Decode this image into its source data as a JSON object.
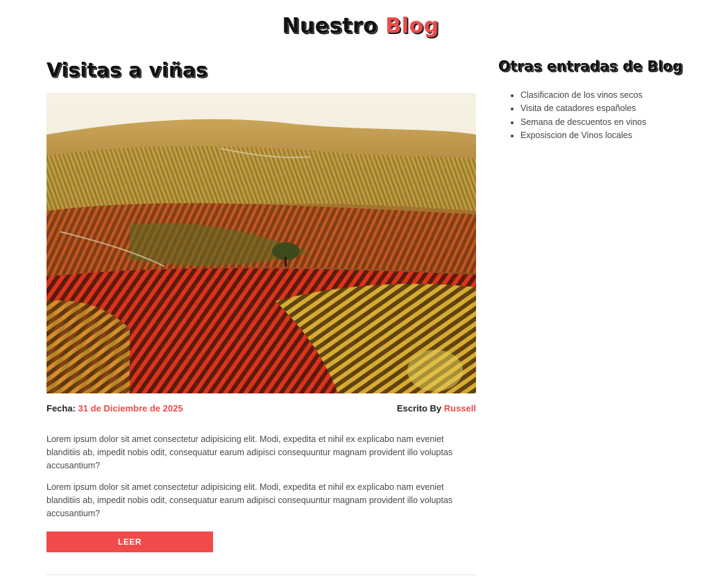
{
  "header": {
    "title_part1": "Nuestro",
    "title_part2": "Blog"
  },
  "post": {
    "title": "Visitas a viñas",
    "date_label": "Fecha:",
    "date_value": "31 de Diciembre de 2025",
    "author_label": "Escrito By",
    "author_value": "Russell",
    "paragraphs": [
      "Lorem ipsum dolor sit amet consectetur adipisicing elit. Modi, expedita et nihil ex explicabo nam eveniet blanditiis ab, impedit nobis odit, consequatur earum adipisci consequuntur magnam provident illo voluptas accusantium?",
      "Lorem ipsum dolor sit amet consectetur adipisicing elit. Modi, expedita et nihil ex explicabo nam eveniet blanditiis ab, impedit nobis odit, consequatur earum adipisci consequuntur magnam provident illo voluptas accusantium?"
    ],
    "button_label": "LEER",
    "image_icon": "vineyard-landscape-image"
  },
  "sidebar": {
    "title": "Otras entradas de Blog",
    "items": [
      "Clasificacion de los vinos secos",
      "Visita de catadores españoles",
      "Semana de descuentos en vinos",
      "Exposiscion de Vinos locales"
    ]
  },
  "colors": {
    "accent": "#f04a4a",
    "text": "#3a3a3a",
    "divider": "#e0e0e0"
  }
}
